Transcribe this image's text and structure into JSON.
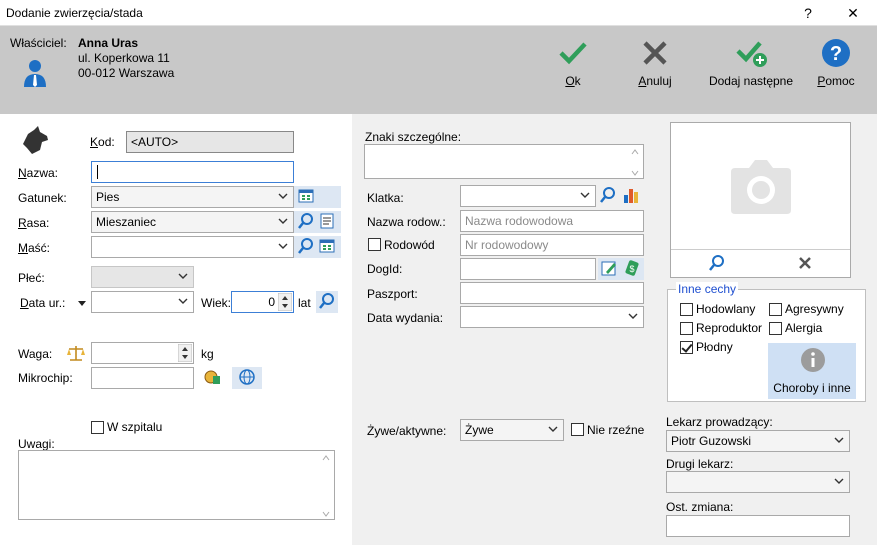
{
  "window": {
    "title": "Dodanie zwierzęcia/stada",
    "help_glyph": "?",
    "close_glyph": "✕"
  },
  "owner": {
    "label": "Właściciel:",
    "name": "Anna Uras",
    "address1": "ul. Koperkowa 11",
    "address2": "00-012  Warszawa"
  },
  "toolbar": {
    "ok": "Ok",
    "cancel": "Anuluj",
    "add_next": "Dodaj następne",
    "help": "Pomoc",
    "colors": {
      "green": "#2f9e5a",
      "gray": "#555555",
      "blue": "#1e6fc4"
    }
  },
  "left": {
    "kod_label": "Kod:",
    "kod_value": "<AUTO>",
    "nazwa_label": "Nazwa:",
    "nazwa_value": "",
    "gatunek_label": "Gatunek:",
    "gatunek_value": "Pies",
    "rasa_label": "Rasa:",
    "rasa_value": "Mieszaniec",
    "masc_label": "Maść:",
    "masc_value": "",
    "plec_label": "Płeć:",
    "plec_value": "",
    "data_ur_label": "Data ur.:",
    "data_ur_value": "",
    "wiek_label": "Wiek:",
    "wiek_value": "0",
    "lat_label": "lat",
    "waga_label": "Waga:",
    "waga_value": "",
    "kg_label": "kg",
    "mikrochip_label": "Mikrochip:",
    "mikrochip_value": "",
    "w_szpitalu_label": "W szpitalu",
    "w_szpitalu_checked": false,
    "uwagi_label": "Uwagi:",
    "uwagi_value": ""
  },
  "middle": {
    "znaki_label": "Znaki szczególne:",
    "znaki_value": "",
    "klatka_label": "Klatka:",
    "klatka_value": "",
    "nazwa_rodow_label": "Nazwa rodow.:",
    "nazwa_rodow_placeholder": "Nazwa rodowodowa",
    "rodowod_label": "Rodowód",
    "rodowod_checked": false,
    "nr_rodowodowy_placeholder": "Nr rodowodowy",
    "dogid_label": "DogId:",
    "dogid_value": "",
    "paszport_label": "Paszport:",
    "paszport_value": "",
    "data_wydania_label": "Data wydania:",
    "data_wydania_value": "",
    "zywe_label": "Żywe/aktywne:",
    "zywe_value": "Żywe",
    "nie_rzezne_label": "Nie rzeźne",
    "nie_rzezne_checked": false
  },
  "right": {
    "inne_cechy_title": "Inne cechy",
    "hodowlany": "Hodowlany",
    "hodowlany_checked": false,
    "agresywny": "Agresywny",
    "agresywny_checked": false,
    "reproduktor": "Reproduktor",
    "reproduktor_checked": false,
    "alergia": "Alergia",
    "alergia_checked": false,
    "plodny": "Płodny",
    "plodny_checked": true,
    "choroby_button": "Choroby i inne",
    "lekarz_label": "Lekarz prowadzący:",
    "lekarz_value": "Piotr Guzowski",
    "drugi_lekarz_label": "Drugi lekarz:",
    "drugi_lekarz_value": "",
    "ost_zmiana_label": "Ost. zmiana:",
    "ost_zmiana_value": ""
  }
}
